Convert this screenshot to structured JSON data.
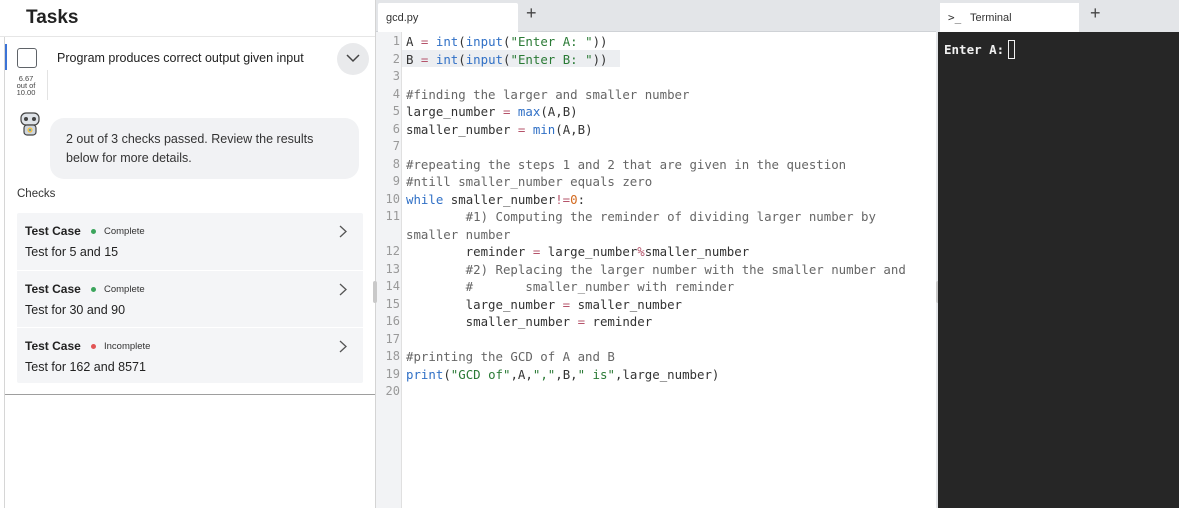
{
  "tasks": {
    "title": "Tasks",
    "task": {
      "label": "Program produces correct output given input",
      "score": "6.67",
      "score_out_of": "out of",
      "score_max": "10.00"
    },
    "feedback": "2 out of 3 checks passed. Review the results below for more details.",
    "checks_label": "Checks",
    "checks": [
      {
        "title": "Test Case",
        "status": "Complete",
        "status_color": "#3ba55c",
        "description": "Test for 5 and 15"
      },
      {
        "title": "Test Case",
        "status": "Complete",
        "status_color": "#3ba55c",
        "description": "Test for 30 and 90"
      },
      {
        "title": "Test Case",
        "status": "Incomplete",
        "status_color": "#e25555",
        "description": "Test for 162 and 8571"
      }
    ]
  },
  "editor": {
    "tab_label": "gcd.py",
    "add_tab": "+",
    "line_numbers": [
      "1",
      "2",
      "3",
      "4",
      "5",
      "6",
      "7",
      "8",
      "9",
      "10",
      "11",
      "12",
      "13",
      "14",
      "15",
      "16",
      "17",
      "18",
      "19",
      "20"
    ]
  },
  "terminal": {
    "tab_icon": ">_",
    "tab_label": "Terminal",
    "add_tab": "+",
    "prompt": "Enter A:"
  },
  "colors": {
    "accent": "#3b73d6",
    "complete": "#3ba55c",
    "incomplete": "#e25555",
    "terminal_bg": "#262626"
  }
}
